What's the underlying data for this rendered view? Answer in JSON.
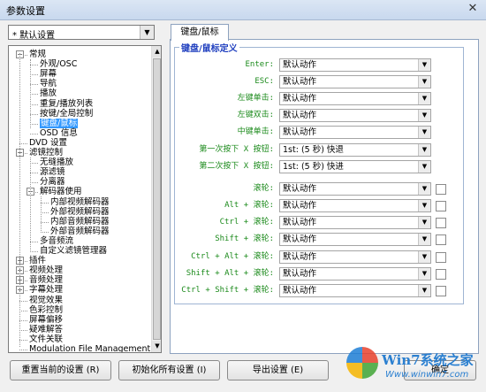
{
  "window": {
    "title": "参数设置",
    "close_glyph": "✕"
  },
  "preset": {
    "value": "* 默认设置"
  },
  "tree": [
    {
      "label": "常规",
      "level": 0,
      "expander": "minus"
    },
    {
      "label": "外观/OSC",
      "level": 1
    },
    {
      "label": "屏幕",
      "level": 1
    },
    {
      "label": "导航",
      "level": 1
    },
    {
      "label": "播放",
      "level": 1
    },
    {
      "label": "重复/播放列表",
      "level": 1
    },
    {
      "label": "按键/全局控制",
      "level": 1
    },
    {
      "label": "键盘/鼠标",
      "level": 1,
      "selected": true
    },
    {
      "label": "OSD 信息",
      "level": 1
    },
    {
      "label": "DVD 设置",
      "level": 0
    },
    {
      "label": "滤镜控制",
      "level": 0,
      "expander": "minus"
    },
    {
      "label": "无缝播放",
      "level": 1
    },
    {
      "label": "源滤镜",
      "level": 1
    },
    {
      "label": "分离器",
      "level": 1
    },
    {
      "label": "解码器使用",
      "level": 1,
      "expander": "minus"
    },
    {
      "label": "内部视频解码器",
      "level": 2
    },
    {
      "label": "外部视频解码器",
      "level": 2
    },
    {
      "label": "内部音频解码器",
      "level": 2
    },
    {
      "label": "外部音频解码器",
      "level": 2
    },
    {
      "label": "多音频流",
      "level": 1
    },
    {
      "label": "自定义滤镜管理器",
      "level": 1
    },
    {
      "label": "插件",
      "level": 0,
      "expander": "plus"
    },
    {
      "label": "视频处理",
      "level": 0,
      "expander": "plus"
    },
    {
      "label": "音频处理",
      "level": 0,
      "expander": "plus"
    },
    {
      "label": "字幕处理",
      "level": 0,
      "expander": "plus"
    },
    {
      "label": "视觉效果",
      "level": 0
    },
    {
      "label": "色彩控制",
      "level": 0
    },
    {
      "label": "屏幕偏移",
      "level": 0
    },
    {
      "label": "疑难解答",
      "level": 0
    },
    {
      "label": "文件关联",
      "level": 0
    },
    {
      "label": "Modulation File Management",
      "level": 0
    }
  ],
  "tab": {
    "label": "键盘/鼠标"
  },
  "group": {
    "title": "键盘/鼠标定义"
  },
  "key_rows": [
    {
      "label": "Enter:",
      "value": "默认动作",
      "checkbox": false
    },
    {
      "label": "ESC:",
      "value": "默认动作",
      "checkbox": false
    },
    {
      "label": "左键单击:",
      "value": "默认动作",
      "checkbox": false
    },
    {
      "label": "左键双击:",
      "value": "默认动作",
      "checkbox": false
    },
    {
      "label": "中键单击:",
      "value": "默认动作",
      "checkbox": false
    },
    {
      "label": "第一次按下 X 按钮:",
      "value": "1st: (5 秒) 快退",
      "checkbox": false
    },
    {
      "label": "第二次按下 X 按钮:",
      "value": "1st: (5 秒) 快进",
      "checkbox": false
    },
    {
      "label": "滚轮:",
      "value": "默认动作",
      "checkbox": true
    },
    {
      "label": "Alt + 滚轮:",
      "value": "默认动作",
      "checkbox": true
    },
    {
      "label": "Ctrl + 滚轮:",
      "value": "默认动作",
      "checkbox": true
    },
    {
      "label": "Shift + 滚轮:",
      "value": "默认动作",
      "checkbox": true
    },
    {
      "label": "Ctrl + Alt + 滚轮:",
      "value": "默认动作",
      "checkbox": true
    },
    {
      "label": "Shift + Alt + 滚轮:",
      "value": "默认动作",
      "checkbox": true
    },
    {
      "label": "Ctrl + Shift + 滚轮:",
      "value": "默认动作",
      "checkbox": true
    }
  ],
  "buttons": {
    "reset": "重置当前的设置 (R)",
    "init_all": "初始化所有设置 (I)",
    "export": "导出设置 (E)",
    "ok": "确定"
  },
  "watermark": {
    "brand": "Win7系统之家",
    "url": "Www.winwin7.com"
  }
}
